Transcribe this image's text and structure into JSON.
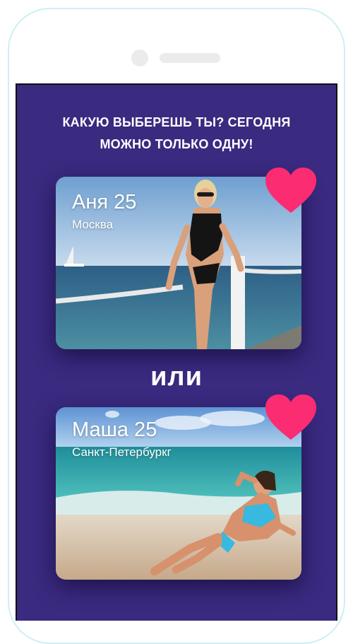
{
  "headline": {
    "line1": "КАКУЮ ВЫБЕРЕШЬ ТЫ? СЕГОДНЯ",
    "line2": "МОЖНО ТОЛЬКО ОДНУ!"
  },
  "cards": [
    {
      "name": "Аня 25",
      "city": "Москва",
      "photo": "beach-pier-photo"
    },
    {
      "name": "Маша 25",
      "city": "Санкт-Петербуркг",
      "photo": "beach-shore-photo"
    }
  ],
  "divider_text": "или",
  "colors": {
    "background": "#3a2a80",
    "heart": "#fb2c72",
    "text": "#ffffff"
  },
  "icons": {
    "like": "heart-icon"
  }
}
